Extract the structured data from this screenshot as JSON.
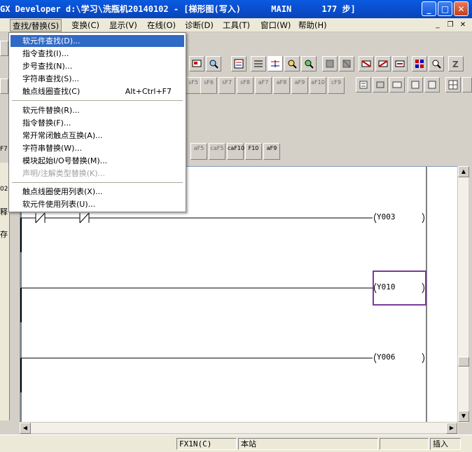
{
  "titlebar": {
    "title": "GX Developer d:\\学习\\洗瓶机20140102 - [梯形图(写入)      MAIN      177 步]"
  },
  "window_controls": {
    "minimize": "_",
    "maximize": "□",
    "close": "✕"
  },
  "menubar": {
    "items": [
      {
        "label": "查找/替换(S)"
      },
      {
        "label": "变换(C)"
      },
      {
        "label": "显示(V)"
      },
      {
        "label": "在线(O)"
      },
      {
        "label": "诊断(D)"
      },
      {
        "label": "工具(T)"
      },
      {
        "label": "窗口(W)"
      },
      {
        "label": "帮助(H)"
      }
    ],
    "mdi": {
      "minimize": "_",
      "restore": "❐",
      "close": "✕"
    }
  },
  "dropdown": {
    "items": [
      {
        "label": "软元件查找(D)...",
        "shortcut": ""
      },
      {
        "label": "指令查找(I)...",
        "shortcut": ""
      },
      {
        "label": "步号查找(N)...",
        "shortcut": ""
      },
      {
        "label": "字符串查找(S)...",
        "shortcut": ""
      },
      {
        "label": "触点线圈查找(C)",
        "shortcut": "Alt+Ctrl+F7"
      },
      {
        "label": "软元件替换(R)...",
        "shortcut": ""
      },
      {
        "label": "指令替换(F)...",
        "shortcut": ""
      },
      {
        "label": "常开常闭触点互换(A)...",
        "shortcut": ""
      },
      {
        "label": "字符串替换(W)...",
        "shortcut": ""
      },
      {
        "label": "模块起始I/O号替换(M)...",
        "shortcut": ""
      },
      {
        "label": "声明/注解类型替换(K)...",
        "shortcut": ""
      },
      {
        "label": "触点线圈使用列表(X)...",
        "shortcut": ""
      },
      {
        "label": "软元件使用列表(U)...",
        "shortcut": ""
      }
    ]
  },
  "keybar1": [
    "sF5",
    "sF6",
    "sF7",
    "sF8",
    "aF7",
    "aF8",
    "aF9",
    "aF10",
    "cF9"
  ],
  "keybar2": [
    "aF5",
    "caF5",
    "caF10",
    "F10",
    "aF9"
  ],
  "left_pane": {
    "labels": [
      "F7",
      "02",
      "释",
      "存"
    ]
  },
  "ladder": {
    "coils": [
      "Y003",
      "Y010",
      "Y006"
    ]
  },
  "statusbar": {
    "plc": "FX1N(C)",
    "station": "本站",
    "mode": "插入"
  },
  "colors": {
    "selection": "#316ac5",
    "cursor_box": "#7a3a9a",
    "titlebar": "#0a4fd0"
  }
}
